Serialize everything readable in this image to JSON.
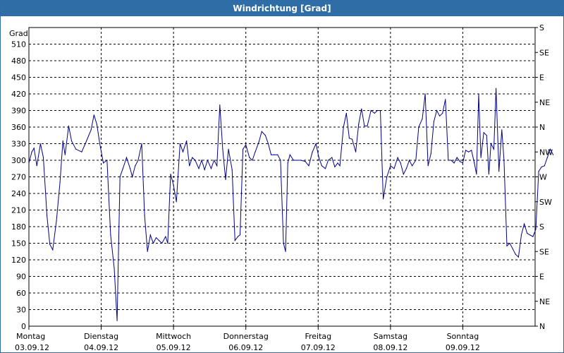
{
  "window": {
    "title": "Windrichtung [Grad]"
  },
  "chart_data": {
    "type": "line",
    "title": "Windrichtung [Grad]",
    "ylabel": "Grad",
    "ylim": [
      0,
      540
    ],
    "yticks": [
      0,
      30,
      60,
      90,
      120,
      150,
      180,
      210,
      240,
      270,
      300,
      330,
      360,
      390,
      420,
      450,
      480,
      510
    ],
    "right_axis_labels": [
      {
        "value": 0,
        "label": "N"
      },
      {
        "value": 30,
        "label": "NE"
      },
      {
        "value": 60,
        "label": "E"
      },
      {
        "value": 90,
        "label": "SE"
      },
      {
        "value": 120,
        "label": "S"
      },
      {
        "value": 150,
        "label": "SW"
      },
      {
        "value": 180,
        "label": "W"
      },
      {
        "value": 210,
        "label": "NW"
      },
      {
        "value": 240,
        "label": "N"
      },
      {
        "value": 270,
        "label": "NE"
      },
      {
        "value": 300,
        "label": "E"
      },
      {
        "value": 330,
        "label": "SE"
      },
      {
        "value": 360,
        "label": "S"
      }
    ],
    "xlim": [
      0,
      7
    ],
    "days": [
      {
        "day": "Montag",
        "date": "03.09.12"
      },
      {
        "day": "Dienstag",
        "date": "04.09.12"
      },
      {
        "day": "Mittwoch",
        "date": "05.09.12"
      },
      {
        "day": "Donnerstag",
        "date": "06.09.12"
      },
      {
        "day": "Freitag",
        "date": "07.09.12"
      },
      {
        "day": "Samstag",
        "date": "08.09.12"
      },
      {
        "day": "Sonntag",
        "date": "09.09.12"
      }
    ],
    "grid": true,
    "line_color": "#00008b",
    "series": [
      {
        "values": [
          [
            0.0,
            295
          ],
          [
            0.04,
            315
          ],
          [
            0.07,
            322
          ],
          [
            0.11,
            290
          ],
          [
            0.16,
            330
          ],
          [
            0.2,
            305
          ],
          [
            0.25,
            200
          ],
          [
            0.29,
            148
          ],
          [
            0.33,
            138
          ],
          [
            0.38,
            190
          ],
          [
            0.43,
            260
          ],
          [
            0.47,
            335
          ],
          [
            0.5,
            310
          ],
          [
            0.55,
            362
          ],
          [
            0.59,
            335
          ],
          [
            0.65,
            320
          ],
          [
            0.73,
            315
          ],
          [
            0.78,
            330
          ],
          [
            0.86,
            355
          ],
          [
            0.9,
            382
          ],
          [
            0.94,
            365
          ],
          [
            0.98,
            330
          ],
          [
            1.03,
            295
          ],
          [
            1.08,
            300
          ],
          [
            1.13,
            165
          ],
          [
            1.18,
            105
          ],
          [
            1.22,
            10
          ],
          [
            1.26,
            270
          ],
          [
            1.3,
            285
          ],
          [
            1.35,
            305
          ],
          [
            1.4,
            285
          ],
          [
            1.43,
            270
          ],
          [
            1.47,
            290
          ],
          [
            1.51,
            300
          ],
          [
            1.56,
            330
          ],
          [
            1.6,
            200
          ],
          [
            1.64,
            135
          ],
          [
            1.68,
            165
          ],
          [
            1.72,
            150
          ],
          [
            1.76,
            160
          ],
          [
            1.8,
            155
          ],
          [
            1.84,
            150
          ],
          [
            1.89,
            162
          ],
          [
            1.92,
            150
          ],
          [
            1.96,
            275
          ],
          [
            2.0,
            255
          ],
          [
            2.04,
            225
          ],
          [
            2.09,
            330
          ],
          [
            2.13,
            315
          ],
          [
            2.18,
            335
          ],
          [
            2.22,
            290
          ],
          [
            2.26,
            305
          ],
          [
            2.3,
            300
          ],
          [
            2.35,
            285
          ],
          [
            2.39,
            300
          ],
          [
            2.43,
            283
          ],
          [
            2.47,
            300
          ],
          [
            2.52,
            285
          ],
          [
            2.56,
            300
          ],
          [
            2.6,
            290
          ],
          [
            2.64,
            400
          ],
          [
            2.68,
            320
          ],
          [
            2.72,
            265
          ],
          [
            2.76,
            320
          ],
          [
            2.81,
            283
          ],
          [
            2.85,
            155
          ],
          [
            2.89,
            162
          ],
          [
            2.92,
            165
          ],
          [
            2.96,
            320
          ],
          [
            3.0,
            328
          ],
          [
            3.05,
            305
          ],
          [
            3.09,
            300
          ],
          [
            3.13,
            315
          ],
          [
            3.18,
            333
          ],
          [
            3.22,
            352
          ],
          [
            3.27,
            345
          ],
          [
            3.31,
            330
          ],
          [
            3.35,
            310
          ],
          [
            3.39,
            310
          ],
          [
            3.44,
            310
          ],
          [
            3.48,
            300
          ],
          [
            3.52,
            150
          ],
          [
            3.55,
            135
          ],
          [
            3.58,
            295
          ],
          [
            3.61,
            310
          ],
          [
            3.66,
            300
          ],
          [
            3.71,
            300
          ],
          [
            3.76,
            300
          ],
          [
            3.82,
            298
          ],
          [
            3.87,
            290
          ],
          [
            3.92,
            315
          ],
          [
            3.97,
            330
          ],
          [
            4.01,
            305
          ],
          [
            4.05,
            290
          ],
          [
            4.1,
            285
          ],
          [
            4.14,
            300
          ],
          [
            4.19,
            305
          ],
          [
            4.23,
            288
          ],
          [
            4.27,
            295
          ],
          [
            4.3,
            290
          ],
          [
            4.35,
            360
          ],
          [
            4.39,
            385
          ],
          [
            4.43,
            340
          ],
          [
            4.47,
            338
          ],
          [
            4.52,
            315
          ],
          [
            4.56,
            365
          ],
          [
            4.6,
            393
          ],
          [
            4.64,
            362
          ],
          [
            4.68,
            362
          ],
          [
            4.73,
            390
          ],
          [
            4.78,
            385
          ],
          [
            4.82,
            390
          ],
          [
            4.86,
            390
          ],
          [
            4.9,
            230
          ],
          [
            4.95,
            270
          ],
          [
            5.0,
            290
          ],
          [
            5.05,
            285
          ],
          [
            5.1,
            305
          ],
          [
            5.14,
            295
          ],
          [
            5.18,
            275
          ],
          [
            5.22,
            285
          ],
          [
            5.26,
            300
          ],
          [
            5.3,
            290
          ],
          [
            5.35,
            300
          ],
          [
            5.39,
            360
          ],
          [
            5.44,
            375
          ],
          [
            5.48,
            420
          ],
          [
            5.52,
            290
          ],
          [
            5.56,
            312
          ],
          [
            5.6,
            370
          ],
          [
            5.64,
            390
          ],
          [
            5.68,
            380
          ],
          [
            5.72,
            385
          ],
          [
            5.76,
            410
          ],
          [
            5.8,
            300
          ],
          [
            5.84,
            300
          ],
          [
            5.88,
            295
          ],
          [
            5.92,
            305
          ],
          [
            5.96,
            298
          ],
          [
            6.0,
            295
          ],
          [
            6.04,
            318
          ],
          [
            6.08,
            315
          ],
          [
            6.12,
            318
          ],
          [
            6.16,
            295
          ],
          [
            6.19,
            275
          ],
          [
            6.22,
            420
          ],
          [
            6.25,
            305
          ],
          [
            6.29,
            350
          ],
          [
            6.33,
            345
          ],
          [
            6.36,
            275
          ],
          [
            6.39,
            330
          ],
          [
            6.43,
            320
          ],
          [
            6.46,
            430
          ],
          [
            6.5,
            280
          ],
          [
            6.54,
            355
          ],
          [
            6.57,
            300
          ],
          [
            6.61,
            145
          ],
          [
            6.65,
            150
          ],
          [
            6.69,
            140
          ],
          [
            6.73,
            130
          ],
          [
            6.77,
            125
          ],
          [
            6.81,
            165
          ],
          [
            6.85,
            185
          ],
          [
            6.89,
            168
          ],
          [
            6.93,
            165
          ],
          [
            6.97,
            162
          ],
          [
            7.01,
            175
          ],
          [
            7.05,
            280
          ],
          [
            7.09,
            288
          ],
          [
            7.13,
            290
          ],
          [
            7.17,
            305
          ],
          [
            7.21,
            320
          ],
          [
            7.25,
            310
          ]
        ]
      }
    ]
  }
}
